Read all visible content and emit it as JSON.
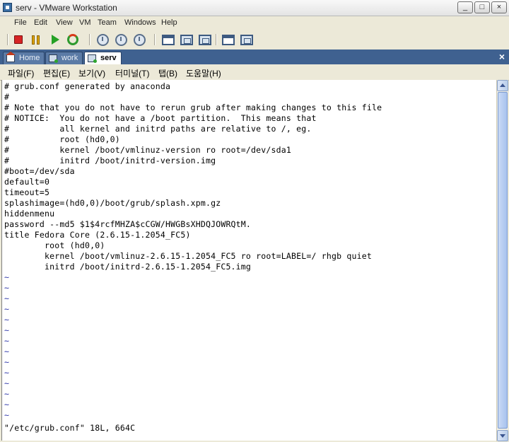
{
  "window": {
    "title": "serv - VMware Workstation",
    "controls": [
      "_",
      "□",
      "×"
    ]
  },
  "menubar": [
    "File",
    "Edit",
    "View",
    "VM",
    "Team",
    "Windows",
    "Help"
  ],
  "tabs": [
    {
      "label": "Home",
      "icon": "home-icon"
    },
    {
      "label": "work",
      "icon": "vm-icon"
    },
    {
      "label": "serv",
      "icon": "vm-icon",
      "active": true
    }
  ],
  "tab_close": "×",
  "terminal_menu": [
    "파일(F)",
    "편집(E)",
    "보기(V)",
    "터미널(T)",
    "탭(B)",
    "도움말(H)"
  ],
  "terminal": {
    "lines": [
      "# grub.conf generated by anaconda",
      "#",
      "# Note that you do not have to rerun grub after making changes to this file",
      "# NOTICE:  You do not have a /boot partition.  This means that",
      "#          all kernel and initrd paths are relative to /, eg.",
      "#          root (hd0,0)",
      "#          kernel /boot/vmlinuz-version ro root=/dev/sda1",
      "#          initrd /boot/initrd-version.img",
      "#boot=/dev/sda",
      "default=0",
      "timeout=5",
      "splashimage=(hd0,0)/boot/grub/splash.xpm.gz",
      "hiddenmenu",
      "password --md5 $1$4rcfMHZA$cCGW/HWGBsXHDQJOWRQtM.",
      "title Fedora Core (2.6.15-1.2054_FC5)",
      "        root (hd0,0)",
      "        kernel /boot/vmlinuz-2.6.15-1.2054_FC5 ro root=LABEL=/ rhgb quiet",
      "        initrd /boot/initrd-2.6.15-1.2054_FC5.img"
    ],
    "tildes": [
      "~",
      "~",
      "~",
      "~",
      "~",
      "~",
      "~",
      "~",
      "~",
      "~",
      "~",
      "~",
      "~",
      "~"
    ],
    "status": "\"/etc/grub.conf\" 18L, 664C"
  },
  "colors": {
    "tab_strip": "#3f6190",
    "tilde": "#2c35a8"
  }
}
